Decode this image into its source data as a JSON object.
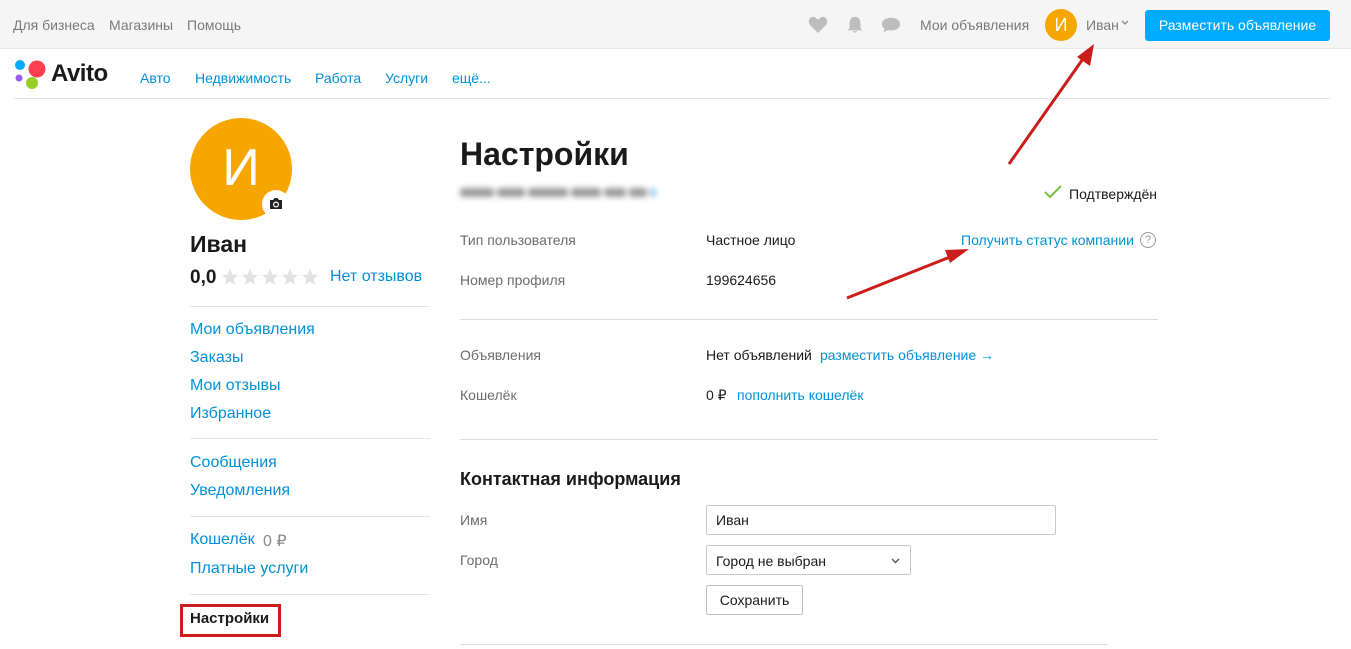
{
  "topbar": {
    "links": [
      "Для бизнеса",
      "Магазины",
      "Помощь"
    ],
    "my_ads": "Мои объявления",
    "avatar_letter": "И",
    "user_name": "Иван",
    "post_button": "Разместить объявление",
    "icons": [
      "heart-icon",
      "bell-icon",
      "chat-icon"
    ]
  },
  "nav": {
    "logo_text": "Avito",
    "links": [
      "Авто",
      "Недвижимость",
      "Работа",
      "Услуги",
      "ещё..."
    ]
  },
  "sidebar": {
    "avatar_letter": "И",
    "name": "Иван",
    "rating": "0,0",
    "stars_filled": 0,
    "stars_total": 5,
    "reviews_link": "Нет отзывов",
    "group1": [
      "Мои объявления",
      "Заказы",
      "Мои отзывы",
      "Избранное"
    ],
    "group2": [
      "Сообщения",
      "Уведомления"
    ],
    "wallet_label": "Кошелёк",
    "wallet_amount": "0 ₽",
    "paid_services": "Платные услуги",
    "settings": "Настройки"
  },
  "main": {
    "title": "Настройки",
    "verified": "Подтверждён",
    "user_type_label": "Тип пользователя",
    "user_type_value": "Частное лицо",
    "company_status_link": "Получить статус компании",
    "help_glyph": "?",
    "profile_number_label": "Номер профиля",
    "profile_number_value": "199624656",
    "ads_label": "Объявления",
    "ads_value": "Нет объявлений",
    "ads_link": "разместить объявление →",
    "wallet_label": "Кошелёк",
    "wallet_value": "0 ₽",
    "wallet_link": "пополнить кошелёк",
    "contact_title": "Контактная информация",
    "name_label": "Имя",
    "name_value": "Иван",
    "city_label": "Город",
    "city_value": "Город не выбран",
    "save_button": "Сохранить"
  },
  "colors": {
    "accent": "#00aaff",
    "link": "#0091d9",
    "avatar": "#f7a600",
    "annotation": "#cc1d1d",
    "verified": "#7bc043"
  }
}
